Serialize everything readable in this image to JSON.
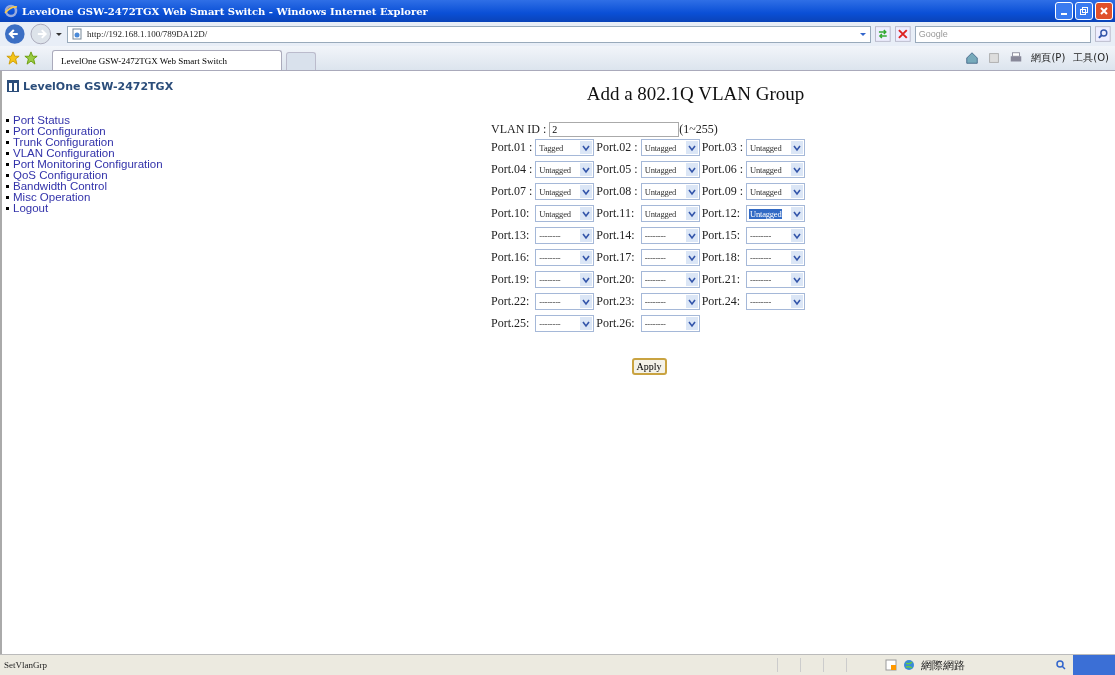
{
  "window": {
    "title": "LevelOne GSW-2472TGX Web Smart Switch - Windows Internet Explorer"
  },
  "address_bar": {
    "url": "http://192.168.1.100/789DA12D/"
  },
  "search": {
    "placeholder": "Google"
  },
  "tabs": [
    {
      "label": "LevelOne GSW-2472TGX Web Smart Switch",
      "selected": true
    }
  ],
  "command_bar": [
    "網頁(P)",
    "工具(O)"
  ],
  "sidebar": {
    "logo": "LevelOne GSW-2472TGX",
    "items": [
      "Port Status",
      "Port Configuration",
      "Trunk Configuration",
      "VLAN Configuration",
      "Port Monitoring Configuration",
      "QoS Configuration",
      "Bandwidth Control",
      "Misc Operation",
      "Logout"
    ]
  },
  "form": {
    "title": "Add a 802.1Q VLAN Group",
    "vlan_id": {
      "label": "VLAN ID :",
      "value": "2",
      "hint": "(1~255)"
    },
    "ports": [
      {
        "label": "Port.01 :",
        "value": "Tagged",
        "selected": false
      },
      {
        "label": "Port.02 :",
        "value": "Untagged",
        "selected": false
      },
      {
        "label": "Port.03 :",
        "value": "Untagged",
        "selected": false
      },
      {
        "label": "Port.04 :",
        "value": "Untagged",
        "selected": false
      },
      {
        "label": "Port.05 :",
        "value": "Untagged",
        "selected": false
      },
      {
        "label": "Port.06 :",
        "value": "Untagged",
        "selected": false
      },
      {
        "label": "Port.07 :",
        "value": "Untagged",
        "selected": false
      },
      {
        "label": "Port.08 :",
        "value": "Untagged",
        "selected": false
      },
      {
        "label": "Port.09 :",
        "value": "Untagged",
        "selected": false
      },
      {
        "label": "Port.10:",
        "value": "Untagged",
        "selected": false
      },
      {
        "label": "Port.11:",
        "value": "Untagged",
        "selected": false
      },
      {
        "label": "Port.12:",
        "value": "Untagged",
        "selected": true
      },
      {
        "label": "Port.13:",
        "value": "--------",
        "selected": false
      },
      {
        "label": "Port.14:",
        "value": "--------",
        "selected": false
      },
      {
        "label": "Port.15:",
        "value": "--------",
        "selected": false
      },
      {
        "label": "Port.16:",
        "value": "--------",
        "selected": false
      },
      {
        "label": "Port.17:",
        "value": "--------",
        "selected": false
      },
      {
        "label": "Port.18:",
        "value": "--------",
        "selected": false
      },
      {
        "label": "Port.19:",
        "value": "--------",
        "selected": false
      },
      {
        "label": "Port.20:",
        "value": "--------",
        "selected": false
      },
      {
        "label": "Port.21:",
        "value": "--------",
        "selected": false
      },
      {
        "label": "Port.22:",
        "value": "--------",
        "selected": false
      },
      {
        "label": "Port.23:",
        "value": "--------",
        "selected": false
      },
      {
        "label": "Port.24:",
        "value": "--------",
        "selected": false
      },
      {
        "label": "Port.25:",
        "value": "--------",
        "selected": false
      },
      {
        "label": "Port.26:",
        "value": "--------",
        "selected": false
      }
    ],
    "apply": "Apply"
  },
  "status_bar": {
    "text": "SetVlanGrp",
    "zone": "網際網路"
  }
}
